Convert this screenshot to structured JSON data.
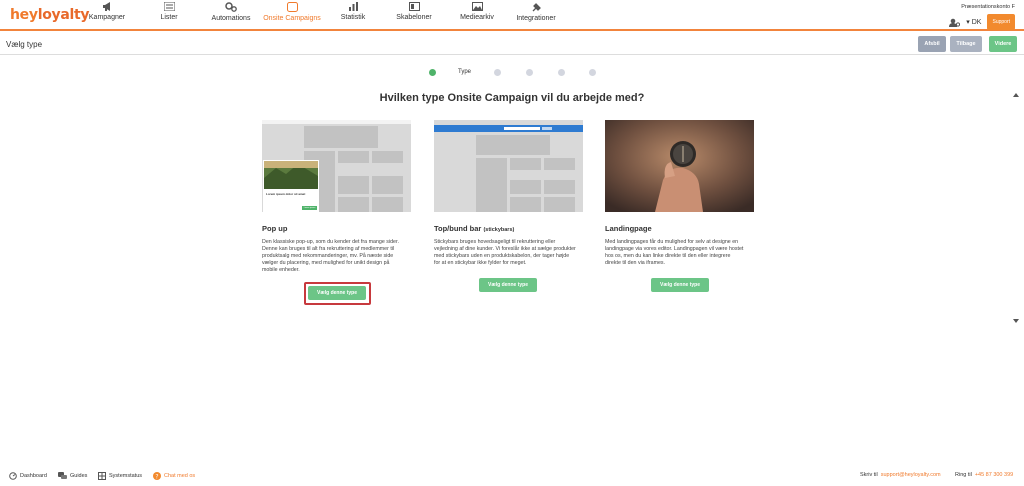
{
  "brand": {
    "logo_part1": "hey",
    "logo_part2": "loyalty"
  },
  "nav": {
    "items": [
      {
        "label": "Kampagner",
        "icon": "megaphone-icon"
      },
      {
        "label": "Lister",
        "icon": "list-icon"
      },
      {
        "label": "Automations",
        "icon": "gears-icon"
      },
      {
        "label": "Onsite Campaigns",
        "icon": "window-icon",
        "active": true
      },
      {
        "label": "Statistik",
        "icon": "bar-chart-icon"
      },
      {
        "label": "Skabeloner",
        "icon": "template-icon"
      },
      {
        "label": "Mediearkiv",
        "icon": "image-icon"
      },
      {
        "label": "Integrationer",
        "icon": "plug-icon"
      }
    ],
    "account": "Præsentationskonto F",
    "language": "▾ DK",
    "support_label": "Support"
  },
  "subbar": {
    "title": "Vælg type",
    "buttons": {
      "cancel": "Afsbil",
      "back": "Tilbage",
      "next": "Videre"
    }
  },
  "steps": {
    "current_label": "Type",
    "total": 6,
    "current_index": 0
  },
  "heading": "Hvilken type Onsite Campaign vil du arbejde med?",
  "cards": [
    {
      "title": "Pop up",
      "title_small": "",
      "desc": "Den klassiske pop-up, som du kender det fra mange sider. Denne kan bruges til alt fra rekruttering af medlemmer til produktsalg med rekommanderinger, mv. På næste side vælger du placering, med mulighed for unikt design på mobile enheder.",
      "button": "Vælg denne type",
      "popup_text": "Lorem ipsum dolor sit amet",
      "popup_btn": "Lorem ipsum"
    },
    {
      "title": "Top/bund bar",
      "title_small": "(stickybars)",
      "desc": "Stickybars bruges hovedsageligt til rekruttering eller vejledning af dine kunder. Vi foreslår ikke at sælge produkter med stickybars uden en produktskabelon, der tager højde for at en stickybar ikke fylder for meget.",
      "button": "Vælg denne type"
    },
    {
      "title": "Landingpage",
      "title_small": "",
      "desc": "Med landingpages får du mulighed for selv at designe en landingpage via vores editor. Landingpagen vil være hostet hos os, men du kan linke direkte til den eller integrere direkte til den via iframes.",
      "button": "Vælg denne type"
    }
  ],
  "footer": {
    "dashboard": "Dashboard",
    "guides": "Guides",
    "systemstatus": "Systemstatus",
    "chat": "Chat med os",
    "write_to": "Skriv til",
    "email": "support@heyloyalty.com",
    "call": "Ring til",
    "phone": "+45 87 300 399"
  },
  "colors": {
    "accent": "#f07a2c",
    "green": "#6cc587",
    "gray_btn": "#9aa3b3",
    "highlight": "#c7393d"
  }
}
